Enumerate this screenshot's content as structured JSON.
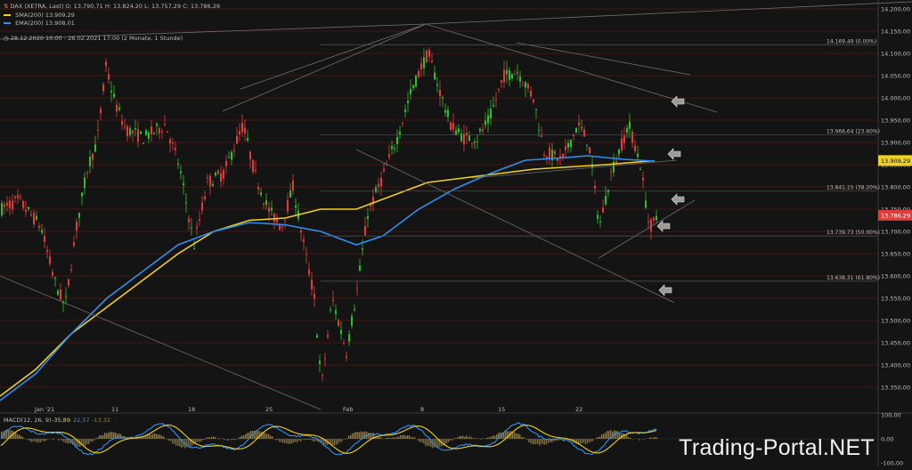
{
  "header": {
    "symbol_line": "DAX (XETRA, Last)   O: 13.790,71   H: 13.824,20   L: 13.757,29   C: 13.786,29",
    "sma_label": "SMA(200)",
    "sma_value": "13.909,29",
    "ema_label": "EMA(200)",
    "ema_value": "13.908,01",
    "range_label": "28.12.2020 10:00 - 26.02.2021 17:00   (2 Monate, 1 Stunde)"
  },
  "branding": {
    "text": "Trading-Portal.NET"
  },
  "colors": {
    "background": "#141414",
    "grid_red": "#4a1414",
    "up": "#2fbf2f",
    "down": "#e23b3b",
    "sma": "#f0d21e",
    "ema": "#2f8ff0",
    "line_gray": "#6e6e6e",
    "last_price_tag": "#e23b3b",
    "sma_tag": "#f0d21e"
  },
  "chart_data": [
    {
      "type": "line",
      "panel": "price",
      "instrument": "DAX (XETRA, Last)",
      "ylim": [
        13350,
        14250
      ],
      "y_ticks": [
        "14.200,00",
        "14.150,00",
        "14.100,00",
        "14.050,00",
        "14.000,00",
        "13.950,00",
        "13.900,00",
        "13.850,00",
        "13.800,00",
        "13.750,00",
        "13.700,00",
        "13.650,00",
        "13.600,00",
        "13.550,00",
        "13.500,00",
        "13.450,00",
        "13.400,00",
        "13.350,00"
      ],
      "x_tick_labels": [
        "Jan '21",
        "11",
        "18",
        "25",
        "Feb",
        "8",
        "15",
        "22"
      ],
      "close_approx": [
        {
          "x": "Jan '21",
          "y": 13760
        },
        {
          "x": "11",
          "y": 13960
        },
        {
          "x": "18",
          "y": 13780
        },
        {
          "x": "25",
          "y": 13640
        },
        {
          "x": "Feb",
          "y": 13700
        },
        {
          "x": "8",
          "y": 14100
        },
        {
          "x": "15",
          "y": 14060
        },
        {
          "x": "22",
          "y": 13760
        }
      ],
      "fib_levels": [
        {
          "label": "14.169,49 (0.00%)",
          "value": 14169.49
        },
        {
          "label": "13.966,64 (23.60%)",
          "value": 13966.64
        },
        {
          "label": "13.841,15 (38.20%)",
          "value": 13841.15
        },
        {
          "label": "13.739,73 (50.00%)",
          "value": 13739.73
        },
        {
          "label": "13.638,31 (61.80%)",
          "value": 13638.31
        }
      ],
      "overlays": [
        {
          "name": "SMA(200)",
          "value": 13909.29
        },
        {
          "name": "EMA(200)",
          "value": 13908.01
        }
      ],
      "price_tags": [
        {
          "text": "13.909,29",
          "value": 13909.29,
          "kind": "sma"
        },
        {
          "text": "13.786,29",
          "value": 13786.29,
          "kind": "last"
        }
      ],
      "ohlc_last": {
        "open": 13790.71,
        "high": 13824.2,
        "low": 13757.29,
        "close": 13786.29
      }
    },
    {
      "type": "line",
      "panel": "macd",
      "title": "MACD(12, 26, 9)",
      "values_shown": [
        "-35,89",
        "22,57",
        "-13,32"
      ],
      "y_ticks": [
        "100,00",
        "0,00",
        "-100,00"
      ],
      "ylim": [
        -100,
        100
      ]
    }
  ]
}
